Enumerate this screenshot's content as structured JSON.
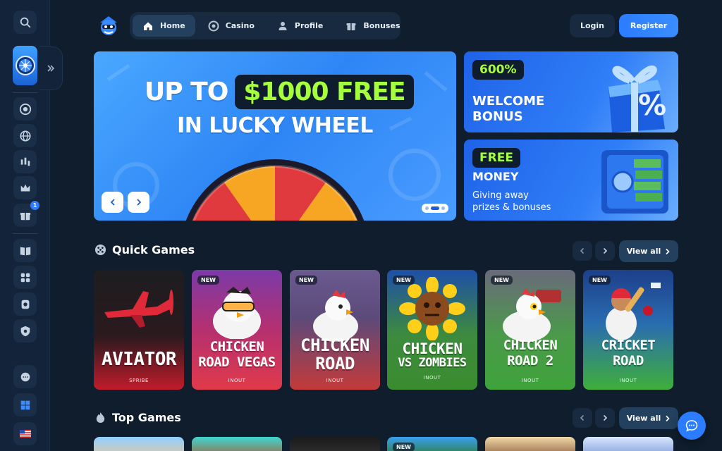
{
  "nav": {
    "items": [
      {
        "label": "Home",
        "icon": "home-icon"
      },
      {
        "label": "Casino",
        "icon": "casino-chip-icon"
      },
      {
        "label": "Profile",
        "icon": "profile-icon"
      },
      {
        "label": "Bonuses",
        "icon": "gift-icon"
      }
    ],
    "active": "Home",
    "login": "Login",
    "register": "Register"
  },
  "sidebar": {
    "bonus_badge": "1",
    "items": [
      "search-icon",
      "lucky-wheel-tile",
      "poker-chip-icon",
      "globe-icon",
      "trading-chart-icon",
      "crown-icon",
      "gift-icon",
      "book-icon",
      "puzzle-icon",
      "badge-icon",
      "shield-icon",
      "chat-support-icon",
      "windows-icon",
      "us-flag-icon"
    ]
  },
  "hero": {
    "line1_prefix": "UP TO",
    "line1_highlight": "$1000 FREE",
    "line2": "IN LUCKY WHEEL",
    "slides": 3,
    "active_slide": 1
  },
  "promos": [
    {
      "pill": "600%",
      "title_1": "WELCOME",
      "title_2": "BONUS"
    },
    {
      "pill": "FREE",
      "title_1": "MONEY",
      "sub_1": "Giving away",
      "sub_2": "prizes & bonuses"
    }
  ],
  "quick_games": {
    "title": "Quick Games",
    "view_all": "View all",
    "games": [
      {
        "name_1": "AVIATOR",
        "name_2": "",
        "provider": "SPRIBE",
        "new": false
      },
      {
        "name_1": "CHICKEN",
        "name_2": "ROAD VEGAS",
        "provider": "INOUT",
        "new": true
      },
      {
        "name_1": "CHICKEN",
        "name_2": "ROAD",
        "provider": "INOUT",
        "new": true
      },
      {
        "name_1": "CHICKEN",
        "name_2": "VS ZOMBIES",
        "provider": "INOUT",
        "new": true
      },
      {
        "name_1": "CHICKEN",
        "name_2": "ROAD 2",
        "provider": "INOUT",
        "new": true
      },
      {
        "name_1": "CRICKET",
        "name_2": "ROAD",
        "provider": "INOUT",
        "new": true
      }
    ],
    "new_label": "NEW"
  },
  "top_games": {
    "title": "Top Games",
    "view_all": "View all",
    "new_label": "NEW"
  },
  "colors": {
    "accent": "#2b7cff",
    "highlight": "#a6ff3c",
    "bg": "#0f1d2c"
  }
}
